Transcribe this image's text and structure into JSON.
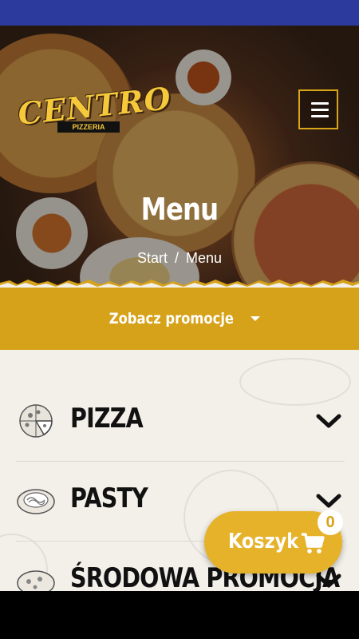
{
  "brand": {
    "logo_text": "CENTRO",
    "logo_subtitle": "PIZZERIA"
  },
  "hero": {
    "title": "Menu",
    "breadcrumb": [
      {
        "label": "Start"
      },
      {
        "label": "Menu"
      }
    ],
    "separator": "/"
  },
  "promo": {
    "label": "Zobacz promocje"
  },
  "categories": [
    {
      "name": "PIZZA",
      "icon": "pizza-slice-icon"
    },
    {
      "name": "PASTY",
      "icon": "pasta-bowl-icon"
    },
    {
      "name": "ŚRODOWA PROMOCJA",
      "icon": "pizza-icon"
    }
  ],
  "cart": {
    "label": "Koszyk",
    "count": "0",
    "icon": "cart-icon"
  },
  "colors": {
    "topbar": "#2b3a9c",
    "accent": "#d6a21a",
    "cart": "#e6b22a",
    "background": "#f3f0ea"
  }
}
